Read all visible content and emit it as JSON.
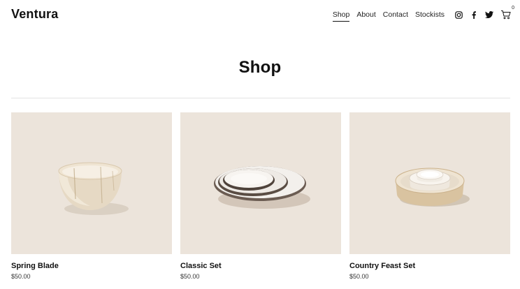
{
  "brand": "Ventura",
  "nav": {
    "items": [
      "Shop",
      "About",
      "Contact",
      "Stockists"
    ],
    "active": "Shop",
    "social": [
      "instagram-icon",
      "facebook-icon",
      "twitter-icon"
    ],
    "cart_count": "0"
  },
  "page": {
    "title": "Shop"
  },
  "products": [
    {
      "name": "Spring Blade",
      "price": "$50.00",
      "image": "bowl"
    },
    {
      "name": "Classic Set",
      "price": "$50.00",
      "image": "plates"
    },
    {
      "name": "Country Feast Set",
      "price": "$50.00",
      "image": "nested-bowls"
    }
  ],
  "colors": {
    "thumb_bg": "#ece4db",
    "text": "#111111"
  }
}
